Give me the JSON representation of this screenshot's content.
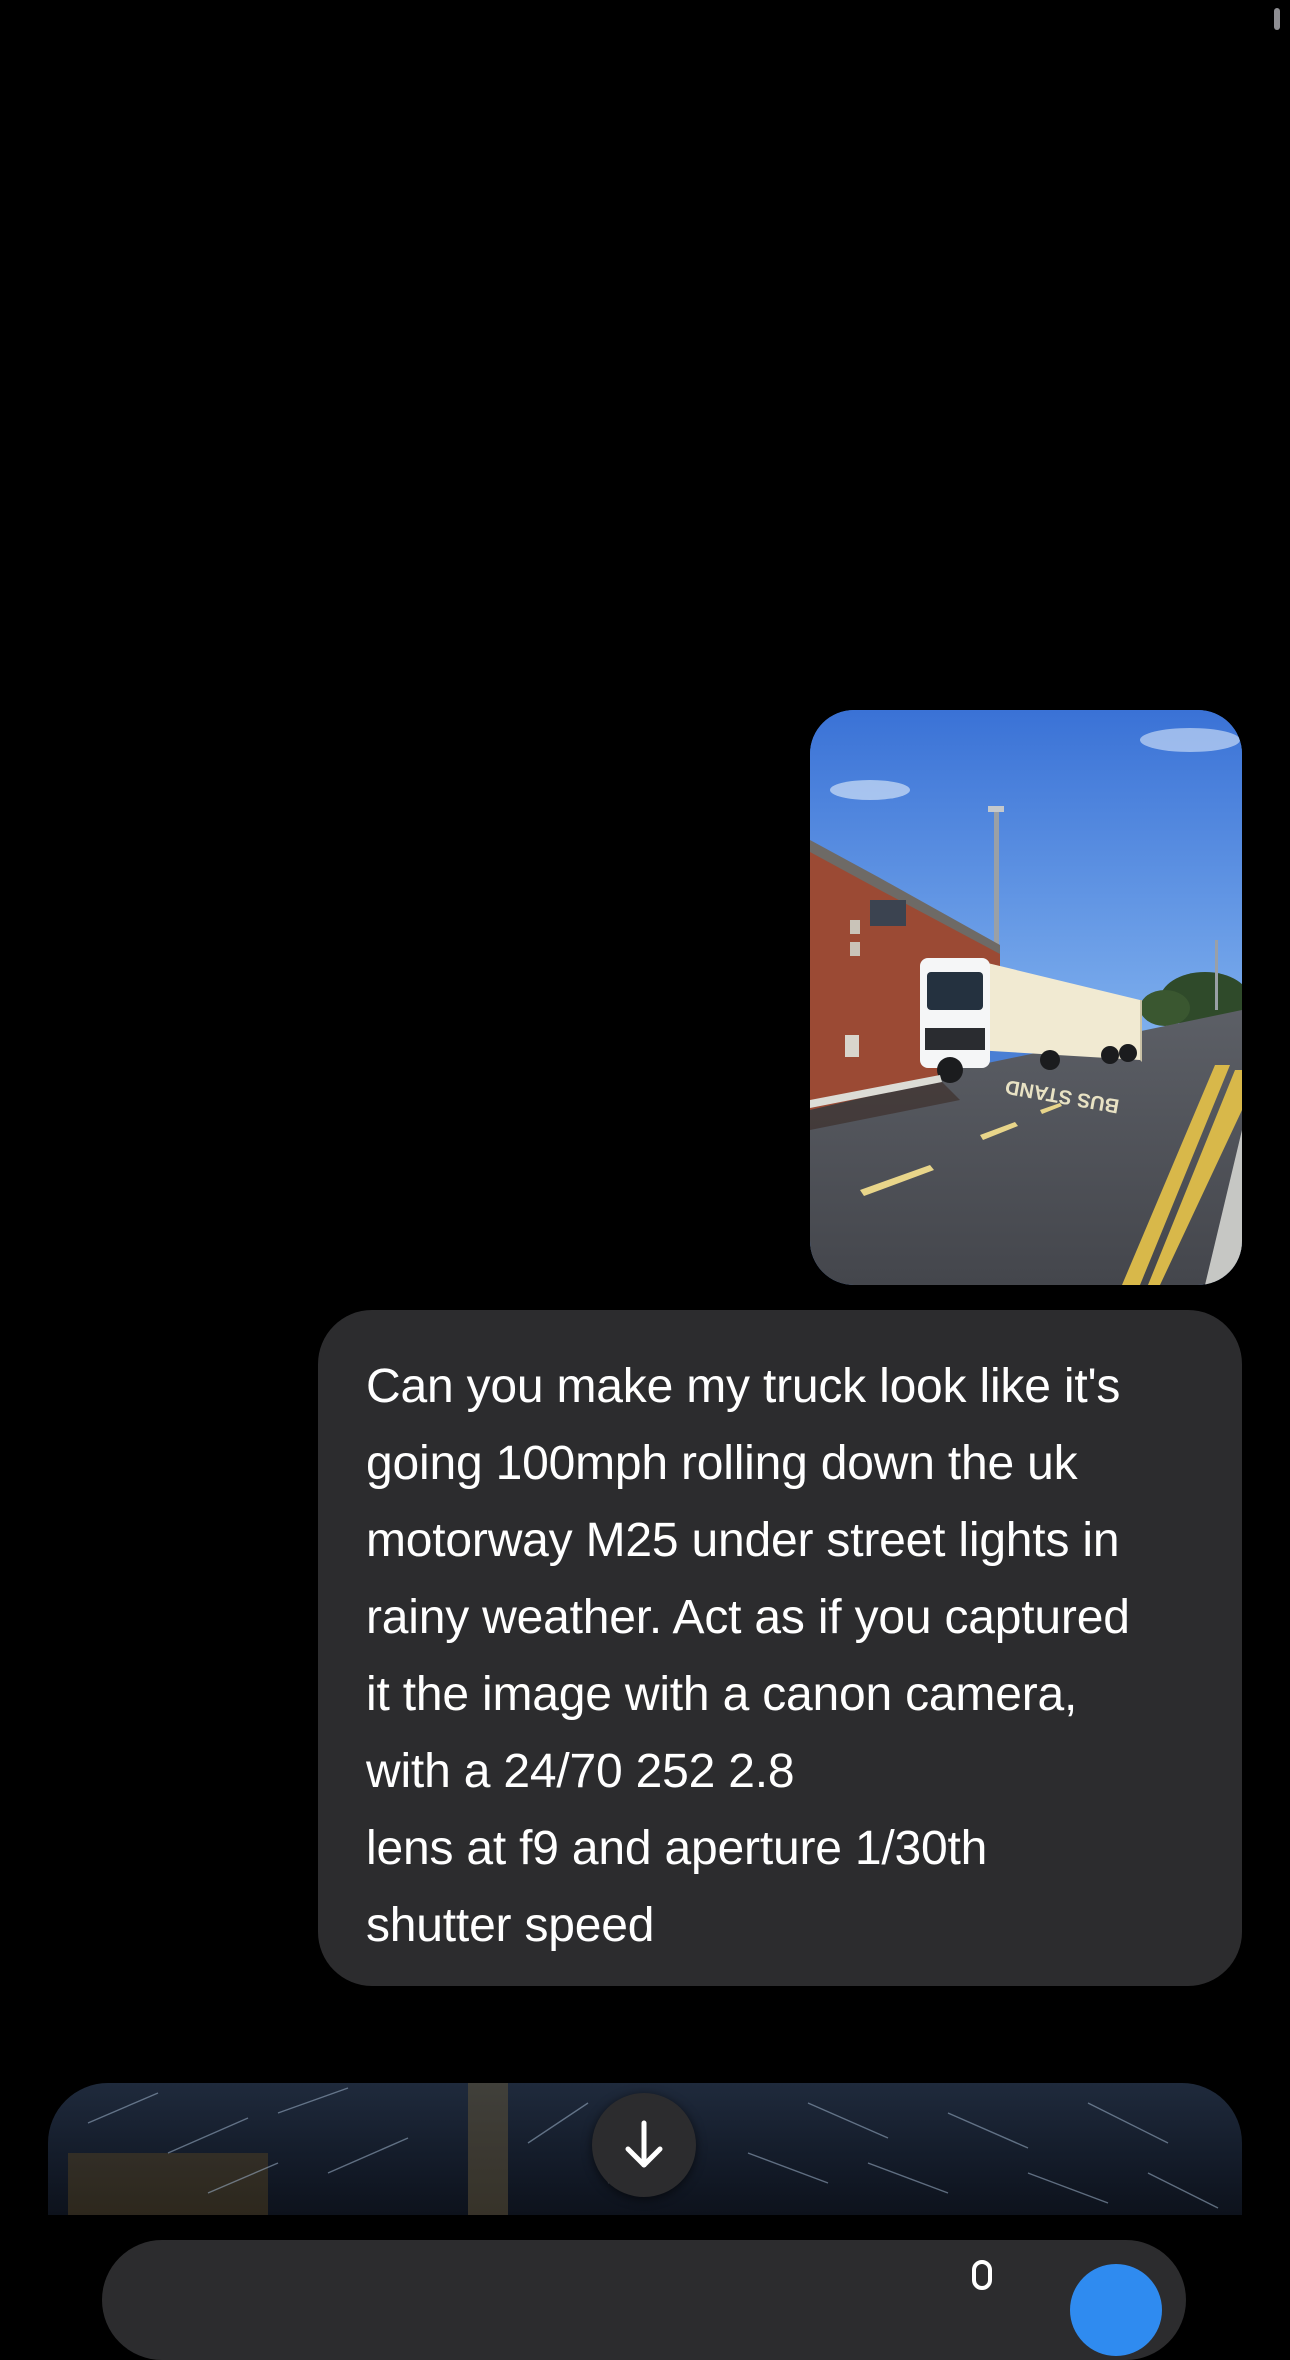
{
  "conversation": {
    "user_message": "Can you make my truck look like it's\ngoing 100mph rolling down the uk\nmotorway M25 under street lights in\nrainy weather. Act as if you captured\nit the image with a canon camera,\nwith a 24/70 252 2.8\nlens at f9 and aperture 1/30th\nshutter speed",
    "photo": {
      "road_marking": "BUS STAND"
    }
  },
  "icons": {
    "scroll_down": "arrow-down-icon",
    "mic": "microphone-icon",
    "send": "send-icon"
  },
  "colors": {
    "background": "#000000",
    "bubble": "#2c2c2e",
    "accent": "#2f8bf0"
  }
}
